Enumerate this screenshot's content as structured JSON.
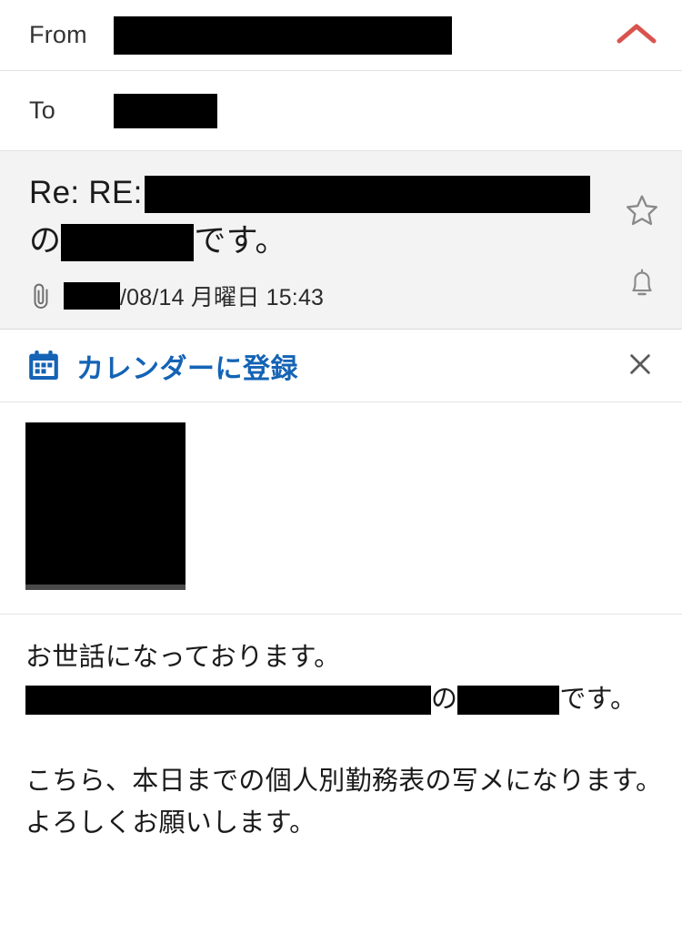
{
  "header": {
    "from_label": "From",
    "to_label": "To",
    "from_value_redacted": true,
    "to_value_redacted": true,
    "collapse_icon": "chevron-up-icon",
    "collapse_color": "#d9534f"
  },
  "subject": {
    "prefix": "Re: RE:",
    "redacted_part_1": true,
    "line2_particle": "の",
    "redacted_part_2": true,
    "line2_suffix": "です。",
    "attachment_icon": "paperclip-icon",
    "date_year_redacted": true,
    "date_text": "/08/14 月曜日 15:43",
    "star_icon": "star-icon",
    "bell_icon": "bell-icon",
    "background": "#f3f3f3"
  },
  "calendar_banner": {
    "icon": "calendar-icon",
    "label": "カレンダーに登録",
    "accent_color": "#1463b5",
    "close_icon": "close-icon"
  },
  "attachment": {
    "thumbnail_redacted": true,
    "name": "attachment-thumbnail"
  },
  "body": {
    "line1": "お世話になっております。",
    "line2_particle": "の",
    "line2_suffix": "です。",
    "line3": "こちら、本日までの個人別勤務表の写メになります。",
    "line4": "よろしくお願いします。"
  }
}
